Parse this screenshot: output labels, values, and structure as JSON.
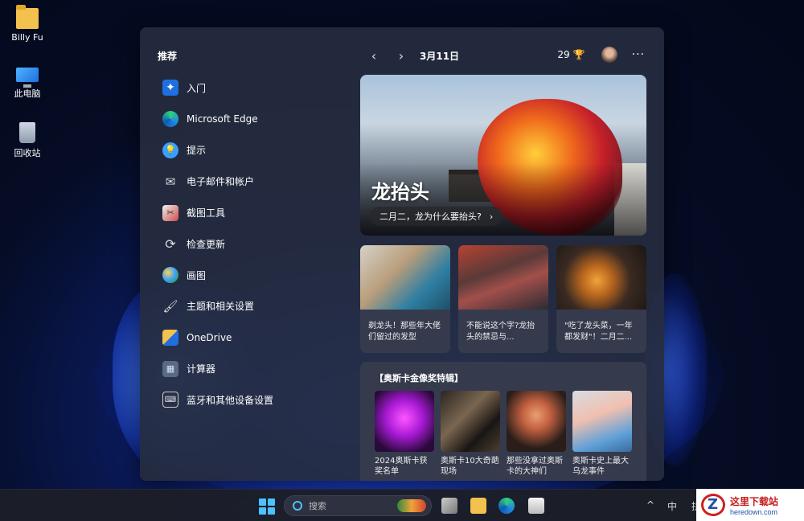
{
  "desktop": {
    "icons": [
      {
        "label": "Billy Fu",
        "icon": "folder-icon"
      },
      {
        "label": "此电脑",
        "icon": "this-pc-icon"
      },
      {
        "label": "回收站",
        "icon": "recycle-bin-icon"
      }
    ]
  },
  "widgets": {
    "recommended_title": "推荐",
    "recommended": [
      {
        "label": "入门",
        "icon": "get-started-icon"
      },
      {
        "label": "Microsoft Edge",
        "icon": "edge-icon"
      },
      {
        "label": "提示",
        "icon": "tips-icon"
      },
      {
        "label": "电子邮件和帐户",
        "icon": "mail-icon"
      },
      {
        "label": "截图工具",
        "icon": "snipping-tool-icon"
      },
      {
        "label": "检查更新",
        "icon": "update-icon"
      },
      {
        "label": "画图",
        "icon": "paint-icon"
      },
      {
        "label": "主题和相关设置",
        "icon": "theme-brush-icon"
      },
      {
        "label": "OneDrive",
        "icon": "onedrive-icon"
      },
      {
        "label": "计算器",
        "icon": "calculator-icon"
      },
      {
        "label": "蓝牙和其他设备设置",
        "icon": "bluetooth-devices-icon"
      }
    ],
    "date": "3月11日",
    "temperature": "29",
    "more": "···",
    "hero": {
      "title": "龙抬头",
      "subtitle": "二月二，龙为什么要抬头?"
    },
    "news": [
      {
        "text": "剃龙头！那些年大佬们留过的发型"
      },
      {
        "text": "不能说这个字?龙抬头的禁忌与..."
      },
      {
        "text": "\"吃了龙头菜，一年都发财\"！二月二..."
      }
    ],
    "oscar": {
      "title": "【奥斯卡金像奖特辑】",
      "items": [
        {
          "text": "2024奥斯卡获奖名单"
        },
        {
          "text": "奥斯卡10大奇葩现场"
        },
        {
          "text": "那些没拿过奥斯卡的大神们"
        },
        {
          "text": "奥斯卡史上最大乌龙事件"
        }
      ]
    }
  },
  "taskbar": {
    "search_placeholder": "搜索",
    "tray_chevron": "^",
    "ime": "中",
    "ime2": "拼"
  },
  "watermark": {
    "line1": "这里下载站",
    "line2": "heredown.com"
  },
  "colors": {
    "accent": "#4cc2ff",
    "panel": "#262c3e"
  }
}
